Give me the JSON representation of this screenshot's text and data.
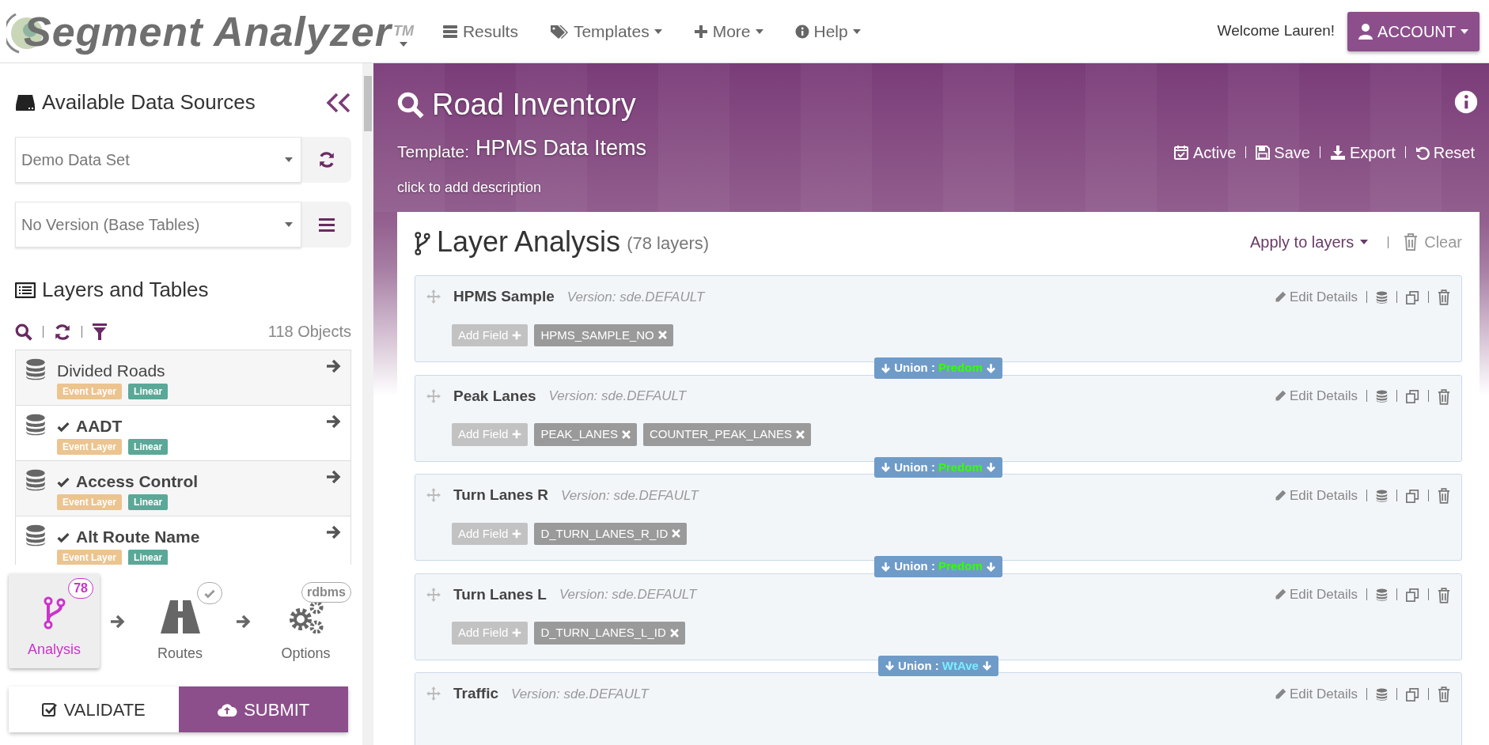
{
  "logo": {
    "title": "Segment Analyzer",
    "mark": "TM"
  },
  "nav": [
    {
      "label": "Results",
      "dropdown": false
    },
    {
      "label": "Templates",
      "dropdown": true
    },
    {
      "label": "More",
      "dropdown": true
    },
    {
      "label": "Help",
      "dropdown": true
    }
  ],
  "welcome": "Welcome Lauren!",
  "account": "ACCOUNT",
  "sidebar": {
    "sources_title": "Available Data Sources",
    "data_source": "Demo Data Set",
    "version": "No Version (Base Tables)",
    "layers_title": "Layers and Tables",
    "object_count": "118 Objects",
    "layers": [
      {
        "name": "Divided Roads",
        "checked": false,
        "tags": [
          {
            "label": "Event Layer",
            "color": "#ecc48f"
          },
          {
            "label": "Linear",
            "color": "#5aa898"
          }
        ]
      },
      {
        "name": "AADT",
        "checked": true,
        "tags": [
          {
            "label": "Event Layer",
            "color": "#ecc48f"
          },
          {
            "label": "Linear",
            "color": "#5aa898"
          }
        ]
      },
      {
        "name": "Access Control",
        "checked": true,
        "tags": [
          {
            "label": "Event Layer",
            "color": "#ecc48f"
          },
          {
            "label": "Linear",
            "color": "#5aa898"
          }
        ]
      },
      {
        "name": "Alt Route Name",
        "checked": true,
        "tags": [
          {
            "label": "Event Layer",
            "color": "#ecc48f"
          },
          {
            "label": "Linear",
            "color": "#5aa898"
          }
        ]
      }
    ],
    "steps": [
      {
        "kind": "analysis",
        "label": "Analysis",
        "badge": "78",
        "selected": true
      },
      {
        "kind": "routes",
        "label": "Routes",
        "badge_checked": true,
        "selected": false
      },
      {
        "kind": "options",
        "label": "Options",
        "badge": "rdbms",
        "selected": false
      }
    ],
    "validate": "VALIDATE",
    "submit": "SUBMIT"
  },
  "header": {
    "title": "Road Inventory",
    "template_label": "Template:",
    "template_name": "HPMS Data Items",
    "description": "click to add description",
    "actions": [
      {
        "label": "Active"
      },
      {
        "label": "Save"
      },
      {
        "label": "Export"
      },
      {
        "label": "Reset"
      }
    ]
  },
  "analysis": {
    "title": "Layer Analysis",
    "count": "(78 layers)",
    "apply": "Apply to layers",
    "clear": "Clear",
    "layers": [
      {
        "name": "HPMS Sample",
        "version": "Version: sde.DEFAULT",
        "edit": "Edit Details",
        "add_field": "Add Field",
        "fields": [
          "HPMS_SAMPLE_NO"
        ],
        "union": {
          "label": "Union :",
          "method": "Predom",
          "color": "#33ff00"
        }
      },
      {
        "name": "Peak Lanes",
        "version": "Version: sde.DEFAULT",
        "edit": "Edit Details",
        "add_field": "Add Field",
        "fields": [
          "PEAK_LANES",
          "COUNTER_PEAK_LANES"
        ],
        "union": {
          "label": "Union :",
          "method": "Predom",
          "color": "#33ff00"
        }
      },
      {
        "name": "Turn Lanes R",
        "version": "Version: sde.DEFAULT",
        "edit": "Edit Details",
        "add_field": "Add Field",
        "fields": [
          "D_TURN_LANES_R_ID"
        ],
        "union": {
          "label": "Union :",
          "method": "Predom",
          "color": "#33ff00"
        }
      },
      {
        "name": "Turn Lanes L",
        "version": "Version: sde.DEFAULT",
        "edit": "Edit Details",
        "add_field": "Add Field",
        "fields": [
          "D_TURN_LANES_L_ID"
        ],
        "union": {
          "label": "Union :",
          "method": "WtAve",
          "color": "#77eeff"
        }
      },
      {
        "name": "Traffic",
        "version": "Version: sde.DEFAULT",
        "edit": "Edit Details"
      }
    ]
  }
}
